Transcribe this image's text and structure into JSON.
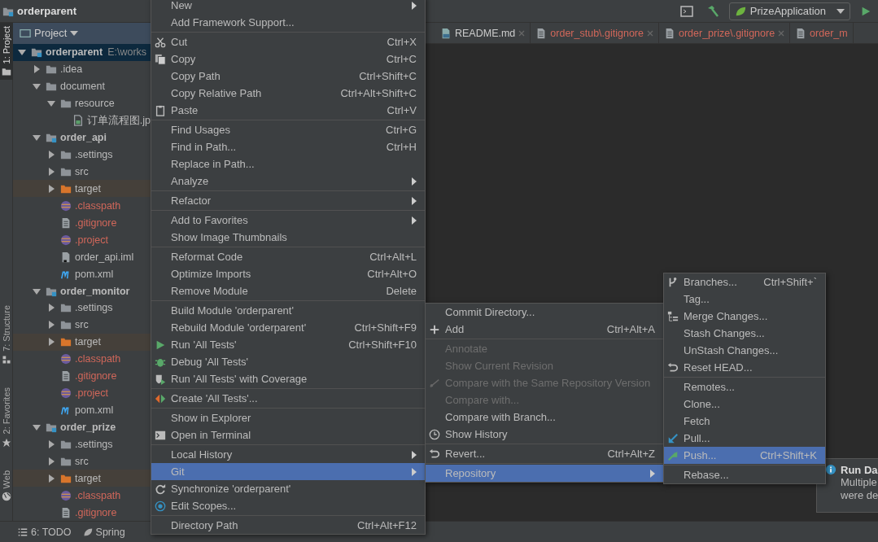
{
  "title": "orderparent",
  "toolbar": {
    "run_config": "PrizeApplication"
  },
  "tool_strip": [
    {
      "label": "1: Project",
      "kind": "project",
      "selected": true
    },
    {
      "label": "7: Structure",
      "kind": "structure",
      "selected": false
    },
    {
      "label": "2: Favorites",
      "kind": "favorites",
      "selected": false
    },
    {
      "label": "Web",
      "kind": "web",
      "selected": false
    }
  ],
  "project_panel": {
    "header": "Project",
    "tree": [
      {
        "label": "orderparent",
        "path": "E:\\works",
        "kind": "module",
        "expanded": true,
        "children": [
          {
            "label": ".idea",
            "kind": "folder",
            "expanded": false
          },
          {
            "label": "document",
            "kind": "folder",
            "expanded": true,
            "children": [
              {
                "label": "resource",
                "kind": "folder",
                "expanded": true,
                "children": [
                  {
                    "label": "订单流程图.jp",
                    "kind": "image",
                    "ignored": false
                  }
                ]
              }
            ]
          },
          {
            "label": "order_api",
            "kind": "module",
            "expanded": true,
            "children": [
              {
                "label": ".settings",
                "kind": "folder",
                "expanded": false
              },
              {
                "label": "src",
                "kind": "folder",
                "expanded": false
              },
              {
                "label": "target",
                "kind": "excluded",
                "expanded": false
              },
              {
                "label": ".classpath",
                "kind": "eclipse",
                "ignored": true
              },
              {
                "label": ".gitignore",
                "kind": "file",
                "ignored": true
              },
              {
                "label": ".project",
                "kind": "eclipse",
                "ignored": true
              },
              {
                "label": "order_api.iml",
                "kind": "iml",
                "ignored": false
              },
              {
                "label": "pom.xml",
                "kind": "maven",
                "ignored": false
              }
            ]
          },
          {
            "label": "order_monitor",
            "kind": "module",
            "expanded": true,
            "children": [
              {
                "label": ".settings",
                "kind": "folder",
                "expanded": false
              },
              {
                "label": "src",
                "kind": "folder",
                "expanded": false
              },
              {
                "label": "target",
                "kind": "excluded",
                "expanded": false
              },
              {
                "label": ".classpath",
                "kind": "eclipse",
                "ignored": true
              },
              {
                "label": ".gitignore",
                "kind": "file",
                "ignored": true
              },
              {
                "label": ".project",
                "kind": "eclipse",
                "ignored": true
              },
              {
                "label": "pom.xml",
                "kind": "maven",
                "ignored": false
              }
            ]
          },
          {
            "label": "order_prize",
            "kind": "module",
            "expanded": true,
            "children": [
              {
                "label": ".settings",
                "kind": "folder",
                "expanded": false
              },
              {
                "label": "src",
                "kind": "folder",
                "expanded": false
              },
              {
                "label": "target",
                "kind": "excluded",
                "expanded": false
              },
              {
                "label": ".classpath",
                "kind": "eclipse",
                "ignored": true
              },
              {
                "label": ".gitignore",
                "kind": "file",
                "ignored": true
              }
            ]
          }
        ]
      }
    ]
  },
  "editor_tabs": [
    {
      "label": "README.md",
      "kind": "markdown",
      "ignored": false,
      "closable": true
    },
    {
      "label": "order_stub\\.gitignore",
      "kind": "file",
      "ignored": true,
      "closable": true
    },
    {
      "label": "order_prize\\.gitignore",
      "kind": "file",
      "ignored": true,
      "closable": true
    },
    {
      "label": "order_m",
      "kind": "file",
      "ignored": true,
      "closable": false
    }
  ],
  "bottom_tools": [
    {
      "label": "6: TODO",
      "kind": "todo"
    },
    {
      "label": "Spring",
      "kind": "spring"
    }
  ],
  "context_menu": {
    "groups": [
      [
        {
          "label": "New",
          "submenu": true,
          "selected": false
        },
        {
          "label": "Add Framework Support...",
          "selected": false
        }
      ],
      [
        {
          "label": "Cut",
          "shortcut": "Ctrl+X",
          "kind": "cut",
          "selected": false
        },
        {
          "label": "Copy",
          "shortcut": "Ctrl+C",
          "kind": "copy",
          "selected": false
        },
        {
          "label": "Copy Path",
          "shortcut": "Ctrl+Shift+C",
          "selected": false
        },
        {
          "label": "Copy Relative Path",
          "shortcut": "Ctrl+Alt+Shift+C",
          "selected": false
        },
        {
          "label": "Paste",
          "shortcut": "Ctrl+V",
          "kind": "paste",
          "selected": false
        }
      ],
      [
        {
          "label": "Find Usages",
          "shortcut": "Ctrl+G",
          "selected": false
        },
        {
          "label": "Find in Path...",
          "shortcut": "Ctrl+H",
          "selected": false
        },
        {
          "label": "Replace in Path...",
          "selected": false
        },
        {
          "label": "Analyze",
          "submenu": true,
          "selected": false
        }
      ],
      [
        {
          "label": "Refactor",
          "submenu": true,
          "selected": false
        }
      ],
      [
        {
          "label": "Add to Favorites",
          "submenu": true,
          "selected": false
        },
        {
          "label": "Show Image Thumbnails",
          "selected": false
        }
      ],
      [
        {
          "label": "Reformat Code",
          "shortcut": "Ctrl+Alt+L",
          "selected": false
        },
        {
          "label": "Optimize Imports",
          "shortcut": "Ctrl+Alt+O",
          "selected": false
        },
        {
          "label": "Remove Module",
          "shortcut": "Delete",
          "selected": false
        }
      ],
      [
        {
          "label": "Build Module 'orderparent'",
          "selected": false
        },
        {
          "label": "Rebuild Module 'orderparent'",
          "shortcut": "Ctrl+Shift+F9",
          "selected": false
        },
        {
          "label": "Run 'All Tests'",
          "shortcut": "Ctrl+Shift+F10",
          "kind": "run",
          "selected": false
        },
        {
          "label": "Debug 'All Tests'",
          "kind": "debug",
          "selected": false
        },
        {
          "label": "Run 'All Tests' with Coverage",
          "kind": "coverage",
          "selected": false
        }
      ],
      [
        {
          "label": "Create 'All Tests'...",
          "kind": "create",
          "selected": false
        }
      ],
      [
        {
          "label": "Show in Explorer",
          "selected": false
        },
        {
          "label": "Open in Terminal",
          "kind": "terminal",
          "selected": false
        }
      ],
      [
        {
          "label": "Local History",
          "submenu": true,
          "selected": false
        },
        {
          "label": "Git",
          "submenu": true,
          "selected": true
        },
        {
          "label": "Synchronize 'orderparent'",
          "kind": "sync",
          "selected": false
        },
        {
          "label": "Edit Scopes...",
          "kind": "scope",
          "selected": false
        }
      ],
      [
        {
          "label": "Directory Path",
          "shortcut": "Ctrl+Alt+F12",
          "selected": false
        }
      ]
    ]
  },
  "git_menu": {
    "groups": [
      [
        {
          "label": "Commit Directory...",
          "disabled": false,
          "selected": false
        },
        {
          "label": "Add",
          "shortcut": "Ctrl+Alt+A",
          "kind": "add",
          "disabled": false,
          "selected": false
        }
      ],
      [
        {
          "label": "Annotate",
          "disabled": true,
          "selected": false
        },
        {
          "label": "Show Current Revision",
          "disabled": true,
          "selected": false
        },
        {
          "label": "Compare with the Same Repository Version",
          "kind": "compare",
          "disabled": true,
          "selected": false
        },
        {
          "label": "Compare with...",
          "disabled": true,
          "selected": false
        },
        {
          "label": "Compare with Branch...",
          "disabled": false,
          "selected": false
        },
        {
          "label": "Show History",
          "kind": "history",
          "disabled": false,
          "selected": false
        }
      ],
      [
        {
          "label": "Revert...",
          "shortcut": "Ctrl+Alt+Z",
          "kind": "revert",
          "disabled": false,
          "selected": false
        }
      ],
      [
        {
          "label": "Repository",
          "submenu": true,
          "disabled": false,
          "selected": true
        }
      ]
    ]
  },
  "repository_menu": {
    "groups": [
      [
        {
          "label": "Branches...",
          "shortcut": "Ctrl+Shift+`",
          "kind": "branch",
          "selected": false
        },
        {
          "label": "Tag...",
          "selected": false
        },
        {
          "label": "Merge Changes...",
          "kind": "merge",
          "selected": false
        },
        {
          "label": "Stash Changes...",
          "selected": false
        },
        {
          "label": "UnStash Changes...",
          "selected": false
        },
        {
          "label": "Reset HEAD...",
          "kind": "revert",
          "selected": false
        }
      ],
      [
        {
          "label": "Remotes...",
          "selected": false
        },
        {
          "label": "Clone...",
          "selected": false
        },
        {
          "label": "Fetch",
          "selected": false
        },
        {
          "label": "Pull...",
          "kind": "pull",
          "selected": false
        },
        {
          "label": "Push...",
          "shortcut": "Ctrl+Shift+K",
          "kind": "push",
          "selected": true
        }
      ],
      [
        {
          "label": "Rebase...",
          "selected": false
        }
      ]
    ]
  },
  "notification": {
    "title": "Run Da",
    "lines": [
      "Multiple",
      "were de"
    ]
  }
}
